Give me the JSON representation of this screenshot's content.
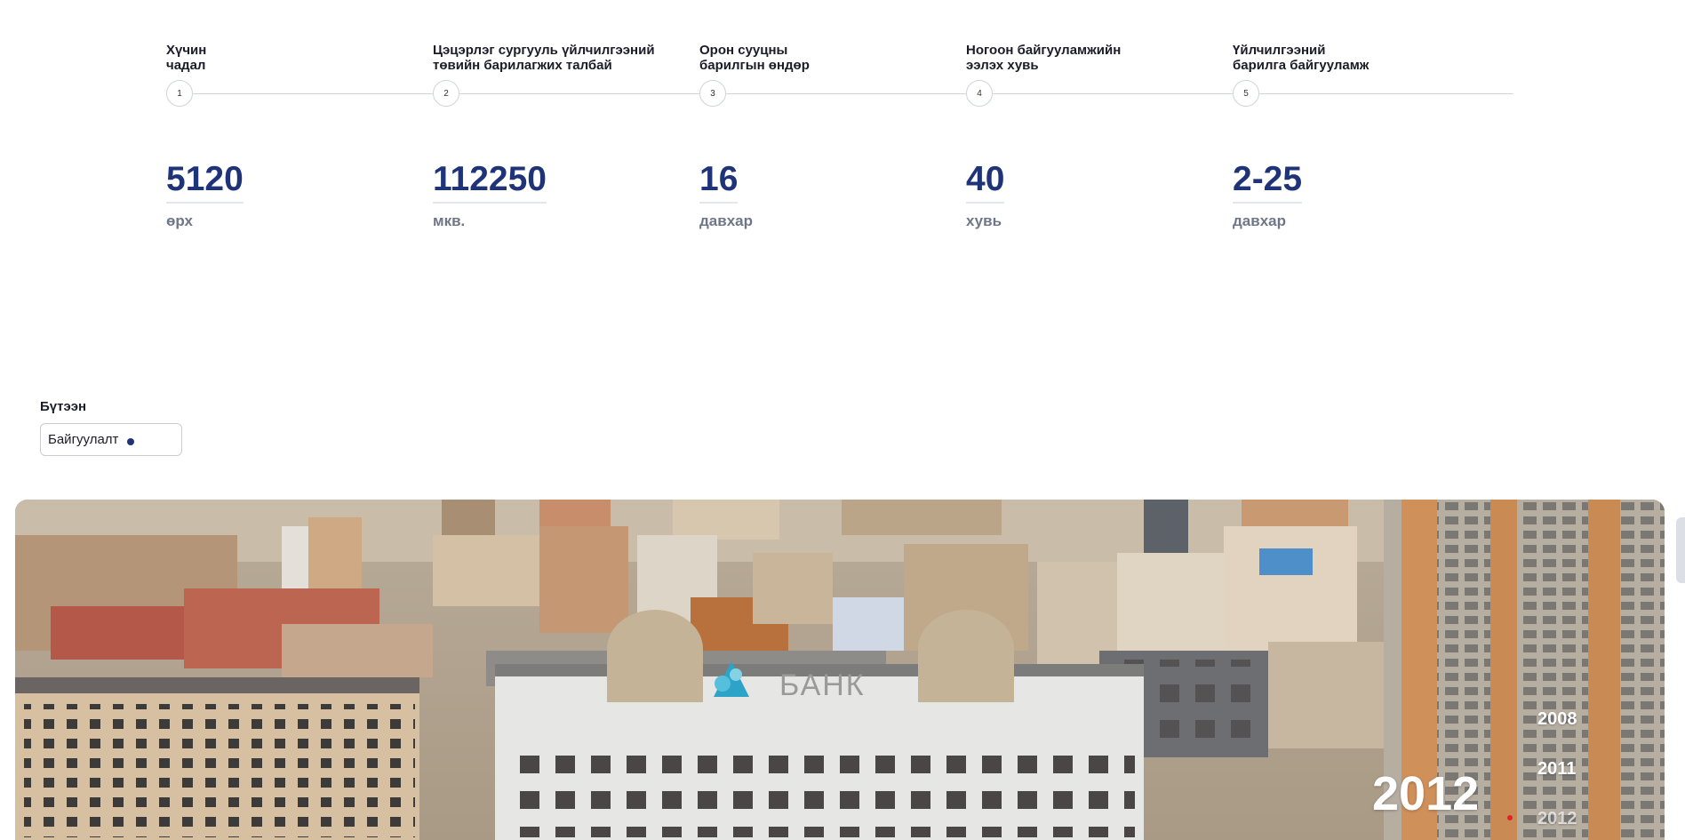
{
  "timeline": {
    "steps": [
      {
        "number": "1",
        "label": "Хүчин\nчадал"
      },
      {
        "number": "2",
        "label": "Цэцэрлэг сургууль үйлчилгээний\nтөвийн барилагжих талбай"
      },
      {
        "number": "3",
        "label": "Орон сууцны\nбарилгын өндөр"
      },
      {
        "number": "4",
        "label": "Ногоон байгууламжийн\nээлэх хувь"
      },
      {
        "number": "5",
        "label": "Үйлчилгээний\nбарилга байгууламж"
      }
    ]
  },
  "stats": [
    {
      "value": "5120",
      "unit": "өрх"
    },
    {
      "value": "112250",
      "unit": "мкв."
    },
    {
      "value": "16",
      "unit": "давхар"
    },
    {
      "value": "40",
      "unit": "хувь"
    },
    {
      "value": "2-25",
      "unit": "давхар"
    }
  ],
  "filter": {
    "label": "Бүтээн",
    "selected": "Байгуулалт"
  },
  "hero": {
    "logo_text": "БАНК",
    "current_year": "2012",
    "years": [
      "2008",
      "2011",
      "2012"
    ],
    "accent_color": "#e0232b"
  },
  "colors": {
    "primary": "#1f3478",
    "muted": "#6f7687"
  }
}
